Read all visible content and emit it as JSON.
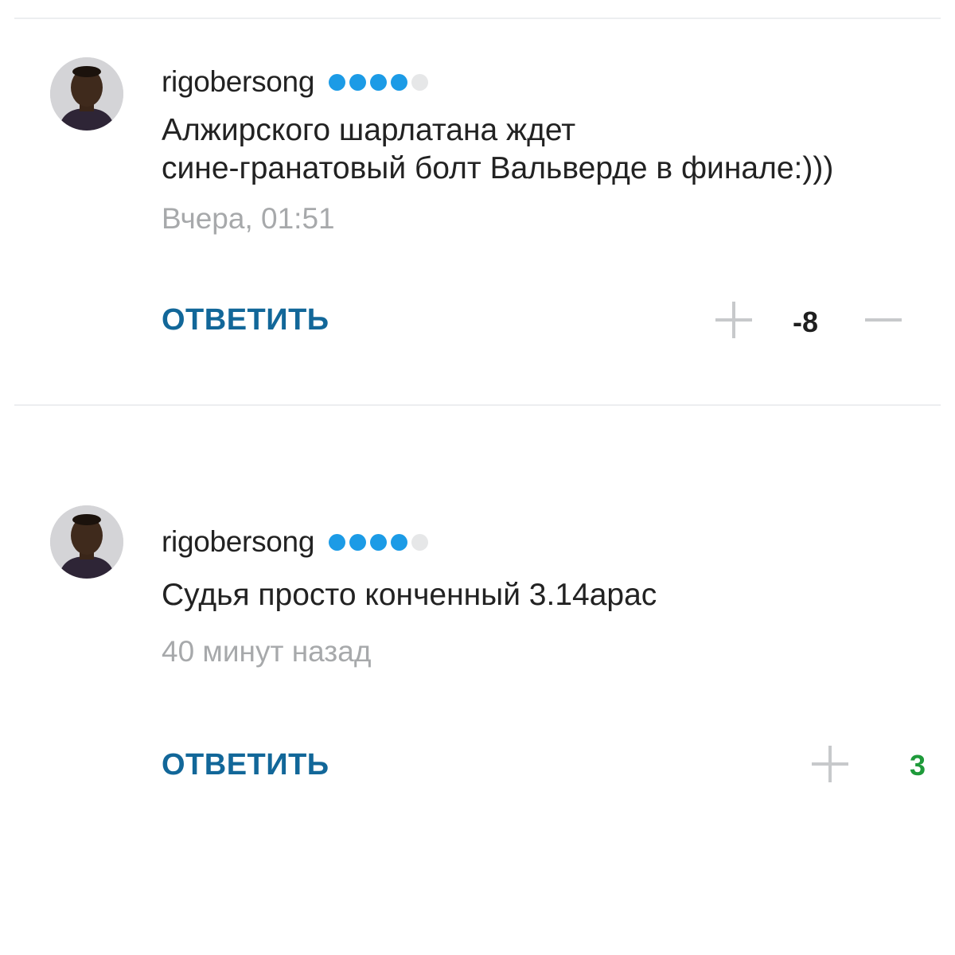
{
  "comments": [
    {
      "username": "rigobersong",
      "text_lines": [
        "Алжирского шарлатана ждет",
        "сине-гранатовый болт Вальверде в финале:)))"
      ],
      "time": "Вчера, 01:51",
      "reply_label": "ОТВЕТИТЬ",
      "score": "-8",
      "score_color": "#1f1f1f"
    },
    {
      "username": "rigobersong",
      "text_lines": [
        "Судья просто конченный 3.14арас"
      ],
      "time": "40 минут назад",
      "reply_label": "ОТВЕТИТЬ",
      "score": "3",
      "score_color": "#1e9a3a"
    }
  ],
  "rating": {
    "filled": 4,
    "total": 5,
    "filled_color": "#1c9be6",
    "empty_color": "#e6e7e8"
  },
  "icons": {
    "upvote": "plus-icon",
    "downvote": "minus-icon"
  }
}
